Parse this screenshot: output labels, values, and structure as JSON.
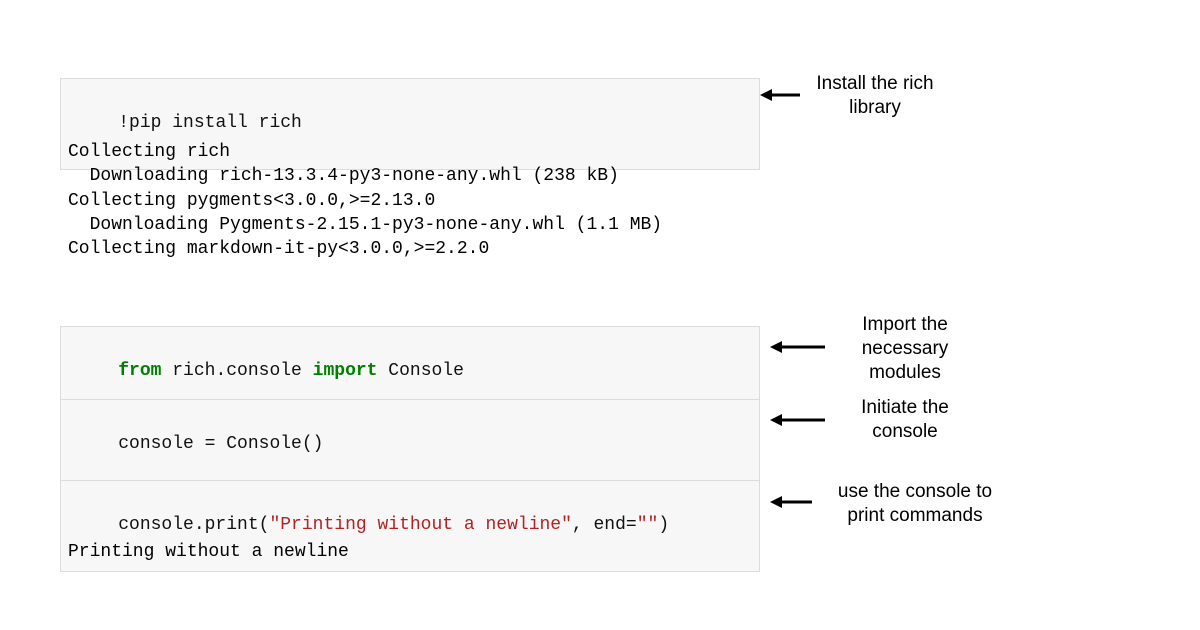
{
  "cells": {
    "install": {
      "bang": "!",
      "cmd": "pip install rich"
    },
    "install_output": "Collecting rich\n  Downloading rich-13.3.4-py3-none-any.whl (238 kB)\nCollecting pygments<3.0.0,>=2.13.0\n  Downloading Pygments-2.15.1-py3-none-any.whl (1.1 MB)\nCollecting markdown-it-py<3.0.0,>=2.2.0",
    "import": {
      "kw_from": "from",
      "module": " rich.console ",
      "kw_import": "import",
      "name": " Console"
    },
    "init": {
      "line": "console = Console()"
    },
    "print": {
      "head": "console.print(",
      "str1": "\"Printing without a newline\"",
      "mid": ", end=",
      "str2": "\"\"",
      "tail": ")"
    },
    "print_output": "Printing without a newline"
  },
  "annotations": {
    "install": "Install the rich\nlibrary",
    "import": "Import the\nnecessary\nmodules",
    "init": "Initiate the\nconsole",
    "print": "use the console to\nprint commands"
  }
}
